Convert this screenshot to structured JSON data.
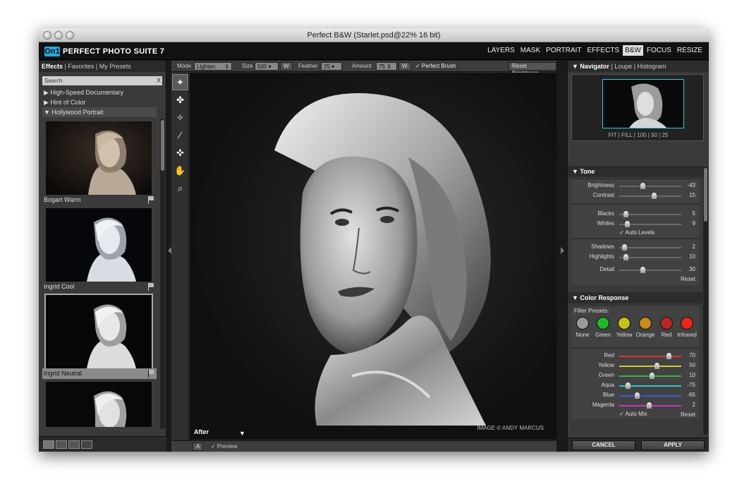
{
  "window": {
    "title": "Perfect B&W (Starlet.psd@22% 16 bit)"
  },
  "app": {
    "logo_mark": "On1",
    "name": "PERFECT PHOTO SUITE 7"
  },
  "modules": [
    "LAYERS",
    "MASK",
    "PORTRAIT",
    "EFFECTS",
    "B&W",
    "FOCUS",
    "RESIZE"
  ],
  "modules_active": "B&W",
  "left": {
    "tab_effects": "Effects",
    "tab_rest": " | Favorites  | My Presets",
    "search_placeholder": "Search",
    "search_clear": "X",
    "tree": [
      "High-Speed Documentary",
      "Hint of Color",
      "Hollywood Portrait"
    ],
    "presets": [
      "Bogart Warm",
      "Ingrid Cool",
      "Ingrid Neutral"
    ]
  },
  "toolbar": {
    "mode_label": "Mode",
    "mode_value": "Lighten",
    "size_label": "Size",
    "size_value": "500",
    "w1": "W",
    "feather_label": "Feather",
    "feather_value": "25",
    "amount_label": "Amount",
    "amount_value": "75",
    "w2": "W",
    "perfect_brush": "✓ Perfect Brush",
    "reset_brightness": "Reset Brightness"
  },
  "canvas": {
    "after_label": "After",
    "credit": "IMAGE © ANDY MARCUS"
  },
  "center_bottom": {
    "a_button": "A",
    "preview": "✓ Preview"
  },
  "navigator": {
    "head": "Navigator",
    "head_rest": " | Loupe | Histogram",
    "zoom": "FIT  |  FILL  |  100  |  50  |  25"
  },
  "tone": {
    "head": "Tone",
    "sliders": [
      {
        "label": "Brightness",
        "value": "-43",
        "pos": 0.38
      },
      {
        "label": "Contrast",
        "value": "15",
        "pos": 0.56
      },
      {
        "label": "Blacks",
        "value": "5",
        "pos": 0.1
      },
      {
        "label": "Whites",
        "value": "9",
        "pos": 0.12
      },
      {
        "label": "Shadows",
        "value": "2",
        "pos": 0.08
      },
      {
        "label": "Highlights",
        "value": "10",
        "pos": 0.1
      },
      {
        "label": "Detail",
        "value": "30",
        "pos": 0.38
      }
    ],
    "auto_levels": "✓ Auto Levels",
    "reset": "Reset"
  },
  "color_response": {
    "head": "Color Response",
    "filter_presets_label": "Filter Presets:",
    "filters": [
      {
        "label": "None",
        "color": "#9a9a9a"
      },
      {
        "label": "Green",
        "color": "#22b82a"
      },
      {
        "label": "Yellow",
        "color": "#c8c21a"
      },
      {
        "label": "Orange",
        "color": "#c98a1c"
      },
      {
        "label": "Red",
        "color": "#b8262a"
      },
      {
        "label": "Infrared",
        "color": "#e8261c"
      }
    ],
    "sliders": [
      {
        "label": "Red",
        "value": "70",
        "pos": 0.79,
        "color": "#d23a3a"
      },
      {
        "label": "Yellow",
        "value": "50",
        "pos": 0.6,
        "color": "#d8c832"
      },
      {
        "label": "Green",
        "value": "10",
        "pos": 0.52,
        "color": "#3ab43a"
      },
      {
        "label": "Aqua",
        "value": "-75",
        "pos": 0.14,
        "color": "#2ec4c4"
      },
      {
        "label": "Blue",
        "value": "-65",
        "pos": 0.28,
        "color": "#3a5ad2"
      },
      {
        "label": "Magenta",
        "value": "2",
        "pos": 0.48,
        "color": "#c23ac2"
      }
    ],
    "auto_mix": "✓ Auto Mix",
    "reset": "Reset"
  },
  "actions": {
    "cancel": "CANCEL",
    "apply": "APPLY"
  },
  "colors": {
    "accent": "#2aa7d9",
    "nav_frame": "#3cc6d6"
  }
}
